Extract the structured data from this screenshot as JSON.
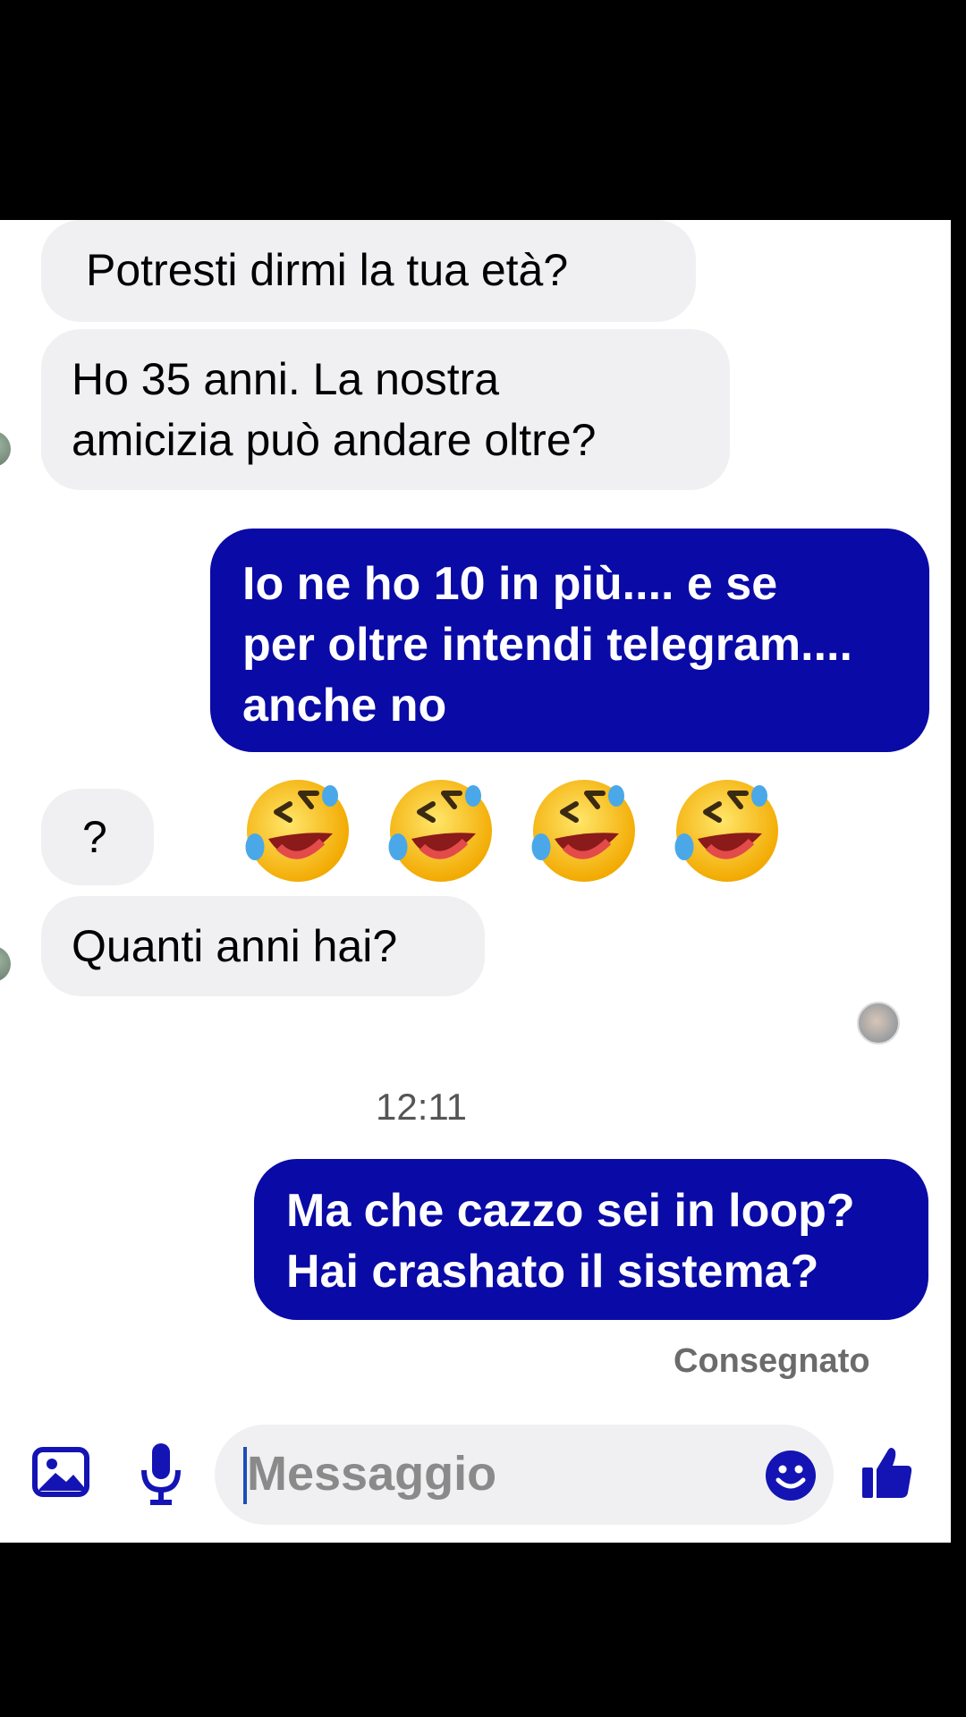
{
  "messages": [
    {
      "side": "in",
      "text": "Potresti dirmi la tua età?"
    },
    {
      "side": "in",
      "lines": [
        "Ho 35 anni. La nostra",
        "amicizia può andare oltre?"
      ]
    },
    {
      "side": "out",
      "lines": [
        "Io ne ho 10 in più.... e se",
        "per oltre intendi telegram....",
        "anche no"
      ]
    },
    {
      "side": "in",
      "text": "?"
    },
    {
      "side": "out",
      "emoji": "rolling-on-floor-laughing",
      "count": 4
    },
    {
      "side": "in",
      "text": "Quanti anni hai?"
    },
    {
      "side": "out",
      "lines": [
        "Ma che cazzo sei in loop?",
        "Hai crashato il sistema?"
      ]
    }
  ],
  "timestamp": "12:11",
  "delivery_status": "Consegnato",
  "composer": {
    "placeholder": "Messaggio",
    "icons": [
      "image-icon",
      "microphone-icon",
      "emoji-icon",
      "thumbs-up-icon"
    ]
  },
  "colors": {
    "outgoing_bubble": "#0a0aa6",
    "incoming_bubble": "#f0f0f2",
    "accent": "#1414b4"
  }
}
